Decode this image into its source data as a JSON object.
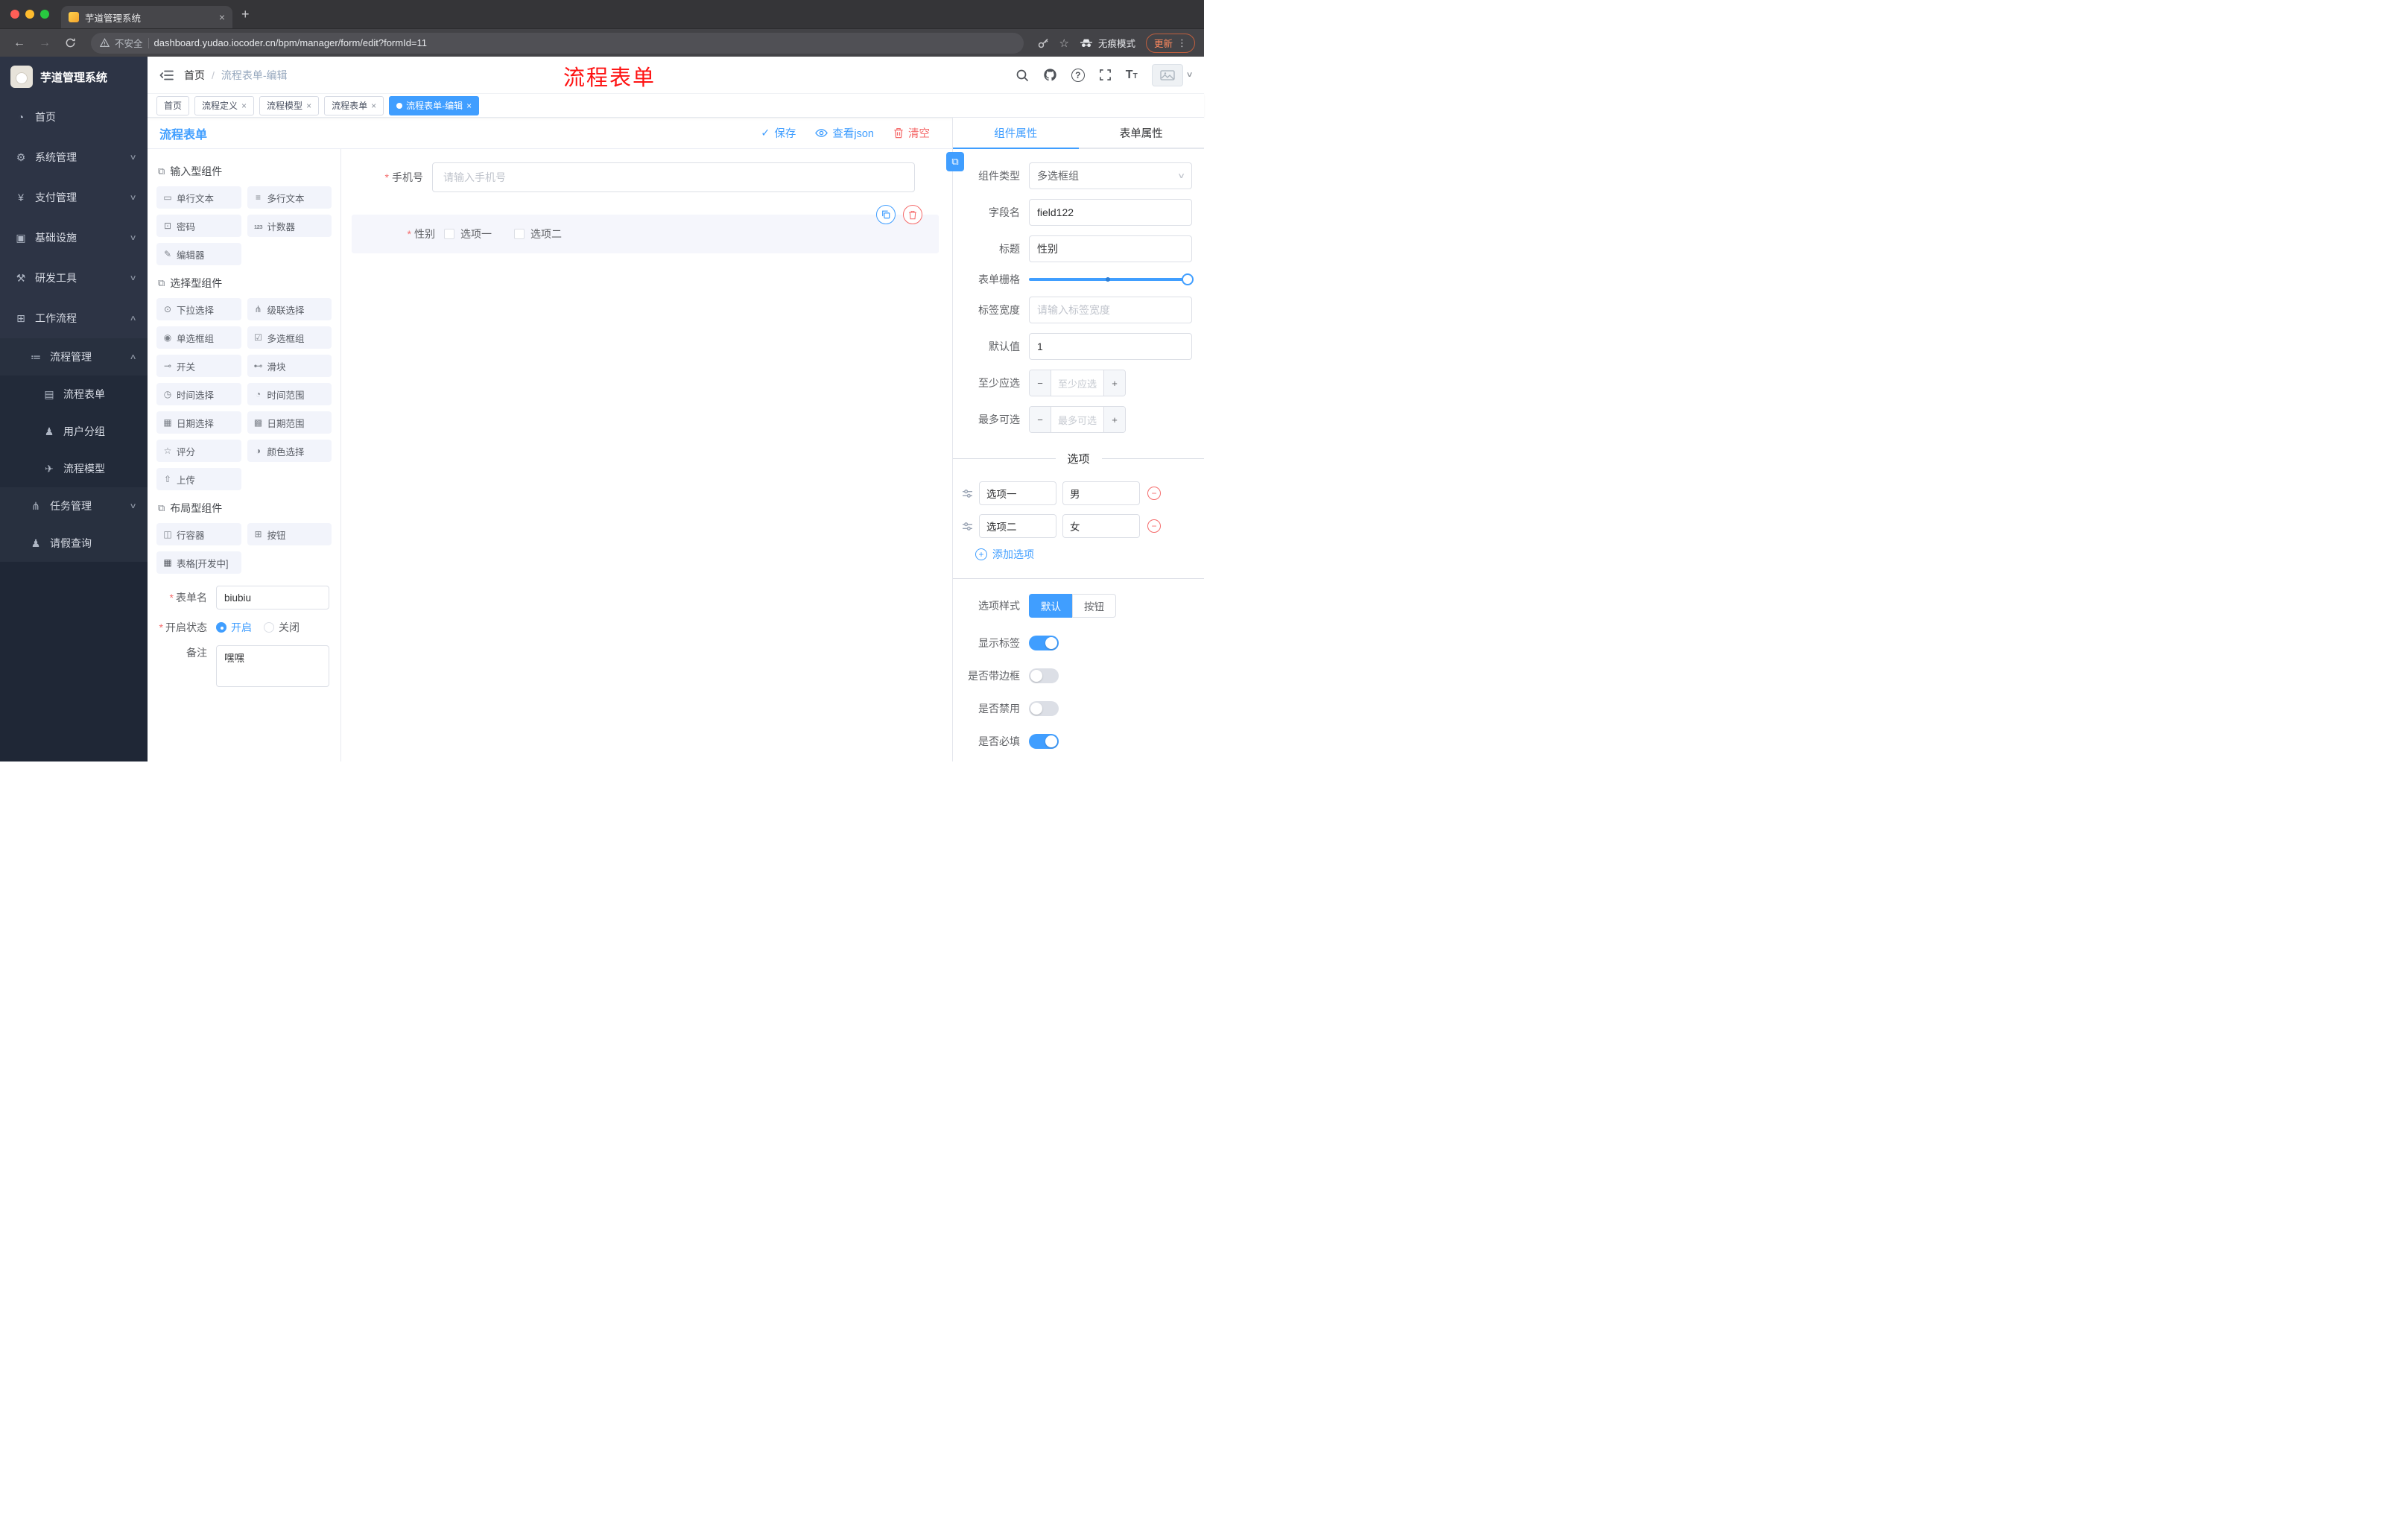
{
  "browser": {
    "tab_title": "芋道管理系统",
    "security_label": "不安全",
    "url": "dashboard.yudao.iocoder.cn/bpm/manager/form/edit?formId=11",
    "incognito_label": "无痕模式",
    "update_label": "更新"
  },
  "sidebar": {
    "logo_title": "芋道管理系统",
    "items": [
      {
        "label": "首页"
      },
      {
        "label": "系统管理"
      },
      {
        "label": "支付管理"
      },
      {
        "label": "基础设施"
      },
      {
        "label": "研发工具"
      },
      {
        "label": "工作流程"
      },
      {
        "label": "流程管理"
      },
      {
        "label": "流程表单"
      },
      {
        "label": "用户分组"
      },
      {
        "label": "流程模型"
      },
      {
        "label": "任务管理"
      },
      {
        "label": "请假查询"
      }
    ]
  },
  "header": {
    "breadcrumb_home": "首页",
    "breadcrumb_current": "流程表单-编辑",
    "annotation": "流程表单"
  },
  "tags": [
    {
      "label": "首页"
    },
    {
      "label": "流程定义"
    },
    {
      "label": "流程模型"
    },
    {
      "label": "流程表单"
    },
    {
      "label": "流程表单-编辑"
    }
  ],
  "editor": {
    "title": "流程表单",
    "save_label": "保存",
    "view_json_label": "查看json",
    "clear_label": "清空"
  },
  "palette": {
    "groups": [
      {
        "title": "输入型组件",
        "items": [
          {
            "label": "单行文本"
          },
          {
            "label": "多行文本"
          },
          {
            "label": "密码"
          },
          {
            "label": "计数器"
          },
          {
            "label": "编辑器"
          }
        ]
      },
      {
        "title": "选择型组件",
        "items": [
          {
            "label": "下拉选择"
          },
          {
            "label": "级联选择"
          },
          {
            "label": "单选框组"
          },
          {
            "label": "多选框组"
          },
          {
            "label": "开关"
          },
          {
            "label": "滑块"
          },
          {
            "label": "时间选择"
          },
          {
            "label": "时间范围"
          },
          {
            "label": "日期选择"
          },
          {
            "label": "日期范围"
          },
          {
            "label": "评分"
          },
          {
            "label": "颜色选择"
          },
          {
            "label": "上传"
          }
        ]
      },
      {
        "title": "布局型组件",
        "items": [
          {
            "label": "行容器"
          },
          {
            "label": "按钮"
          },
          {
            "label": "表格[开发中]"
          }
        ]
      }
    ],
    "form_name_label": "表单名",
    "form_name_value": "biubiu",
    "status_label": "开启状态",
    "status_on_label": "开启",
    "status_off_label": "关闭",
    "remark_label": "备注",
    "remark_value": "嘿嘿"
  },
  "canvas": {
    "phone_label": "手机号",
    "phone_placeholder": "请输入手机号",
    "gender_label": "性别",
    "gender_options": [
      "选项一",
      "选项二"
    ]
  },
  "props": {
    "tab_component": "组件属性",
    "tab_form": "表单属性",
    "component_type_label": "组件类型",
    "component_type_value": "多选框组",
    "field_name_label": "字段名",
    "field_name_value": "field122",
    "title_label": "标题",
    "title_value": "性别",
    "grid_label": "表单栅格",
    "label_width_label": "标签宽度",
    "label_width_placeholder": "请输入标签宽度",
    "default_label": "默认值",
    "default_value": "1",
    "min_label": "至少应选",
    "min_placeholder": "至少应选",
    "max_label": "最多可选",
    "max_placeholder": "最多可选",
    "options_title": "选项",
    "options": [
      {
        "label": "选项一",
        "value": "男"
      },
      {
        "label": "选项二",
        "value": "女"
      }
    ],
    "add_option_label": "添加选项",
    "option_style_label": "选项样式",
    "style_default": "默认",
    "style_button": "按钮",
    "switch_show_label": "显示标签",
    "switch_border_label": "是否带边框",
    "switch_disabled_label": "是否禁用",
    "switch_required_label": "是否必填"
  },
  "colors": {
    "primary": "#409eff",
    "danger": "#f56c6c",
    "annotation": "#fe1212"
  }
}
